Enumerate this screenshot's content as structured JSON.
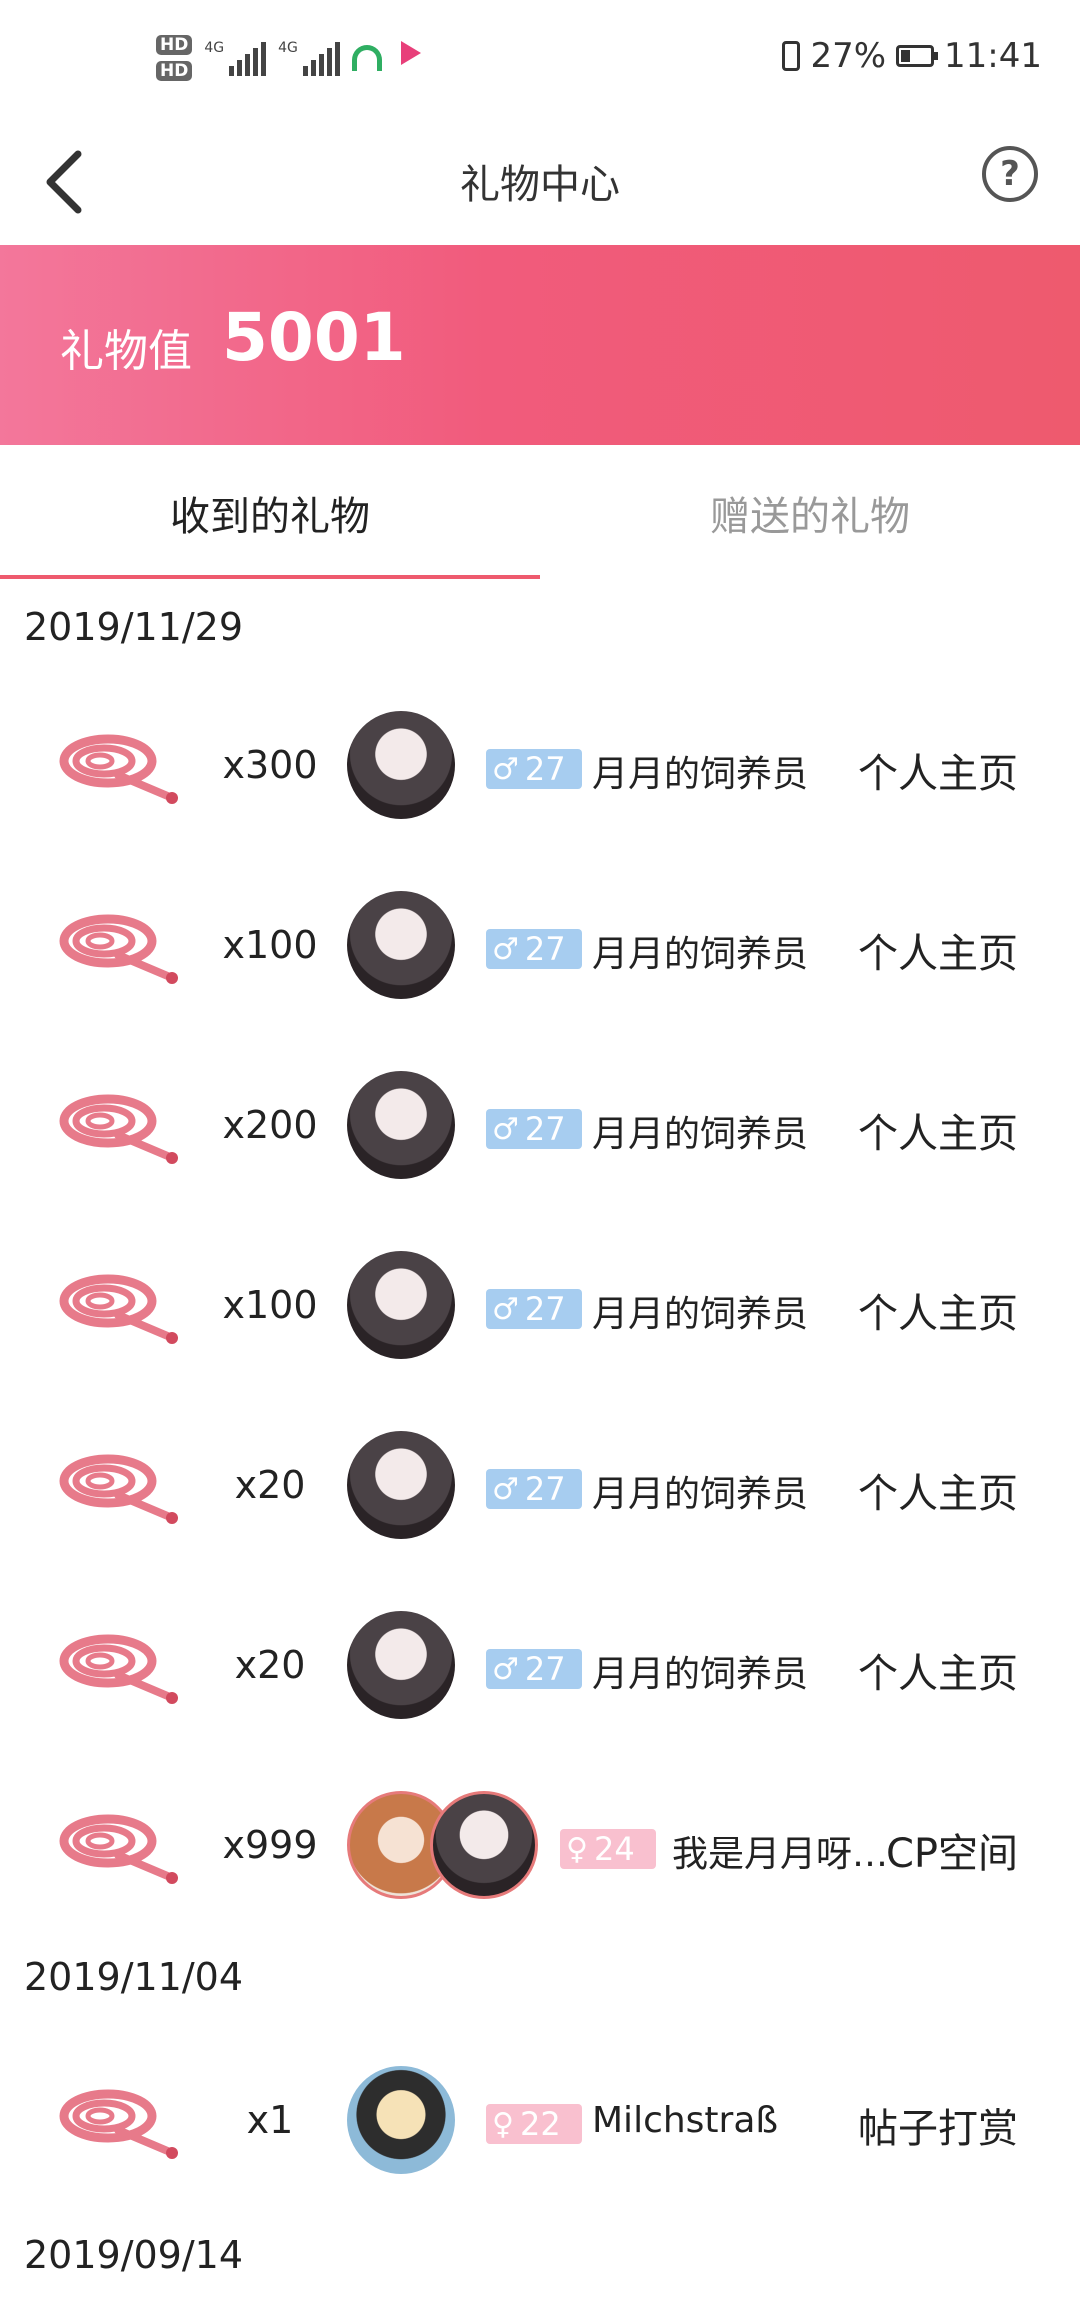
{
  "status_bar": {
    "hd1": "HD",
    "hd2": "HD",
    "net1": "4G",
    "net2": "4G",
    "battery": "27%",
    "time": "11:41"
  },
  "nav": {
    "title": "礼物中心",
    "help": "?"
  },
  "banner": {
    "label": "礼物值",
    "value": "5001"
  },
  "tabs": {
    "received": "收到的礼物",
    "sent": "赠送的礼物"
  },
  "dates": [
    "2019/11/29",
    "2019/11/04",
    "2019/09/14"
  ],
  "rows": [
    {
      "qty": "x300",
      "age": "27",
      "gender": "male",
      "name": "月月的饲养员",
      "action": "个人主页"
    },
    {
      "qty": "x100",
      "age": "27",
      "gender": "male",
      "name": "月月的饲养员",
      "action": "个人主页"
    },
    {
      "qty": "x200",
      "age": "27",
      "gender": "male",
      "name": "月月的饲养员",
      "action": "个人主页"
    },
    {
      "qty": "x100",
      "age": "27",
      "gender": "male",
      "name": "月月的饲养员",
      "action": "个人主页"
    },
    {
      "qty": "x20",
      "age": "27",
      "gender": "male",
      "name": "月月的饲养员",
      "action": "个人主页"
    },
    {
      "qty": "x20",
      "age": "27",
      "gender": "male",
      "name": "月月的饲养员",
      "action": "个人主页"
    },
    {
      "qty": "x999",
      "age": "24",
      "gender": "female",
      "name": "我是月月呀…",
      "action": "CP空间"
    },
    {
      "qty": "x1",
      "age": "22",
      "gender": "female",
      "name": "Milchstraß",
      "action": "帖子打赏"
    }
  ],
  "colors": {
    "accent": "#ee5a6e",
    "male_badge": "#a7cdf0",
    "female_badge": "#f9c0cf"
  },
  "icons": {
    "gift": "whip-icon",
    "back": "back-arrow-icon",
    "help": "help-icon"
  }
}
